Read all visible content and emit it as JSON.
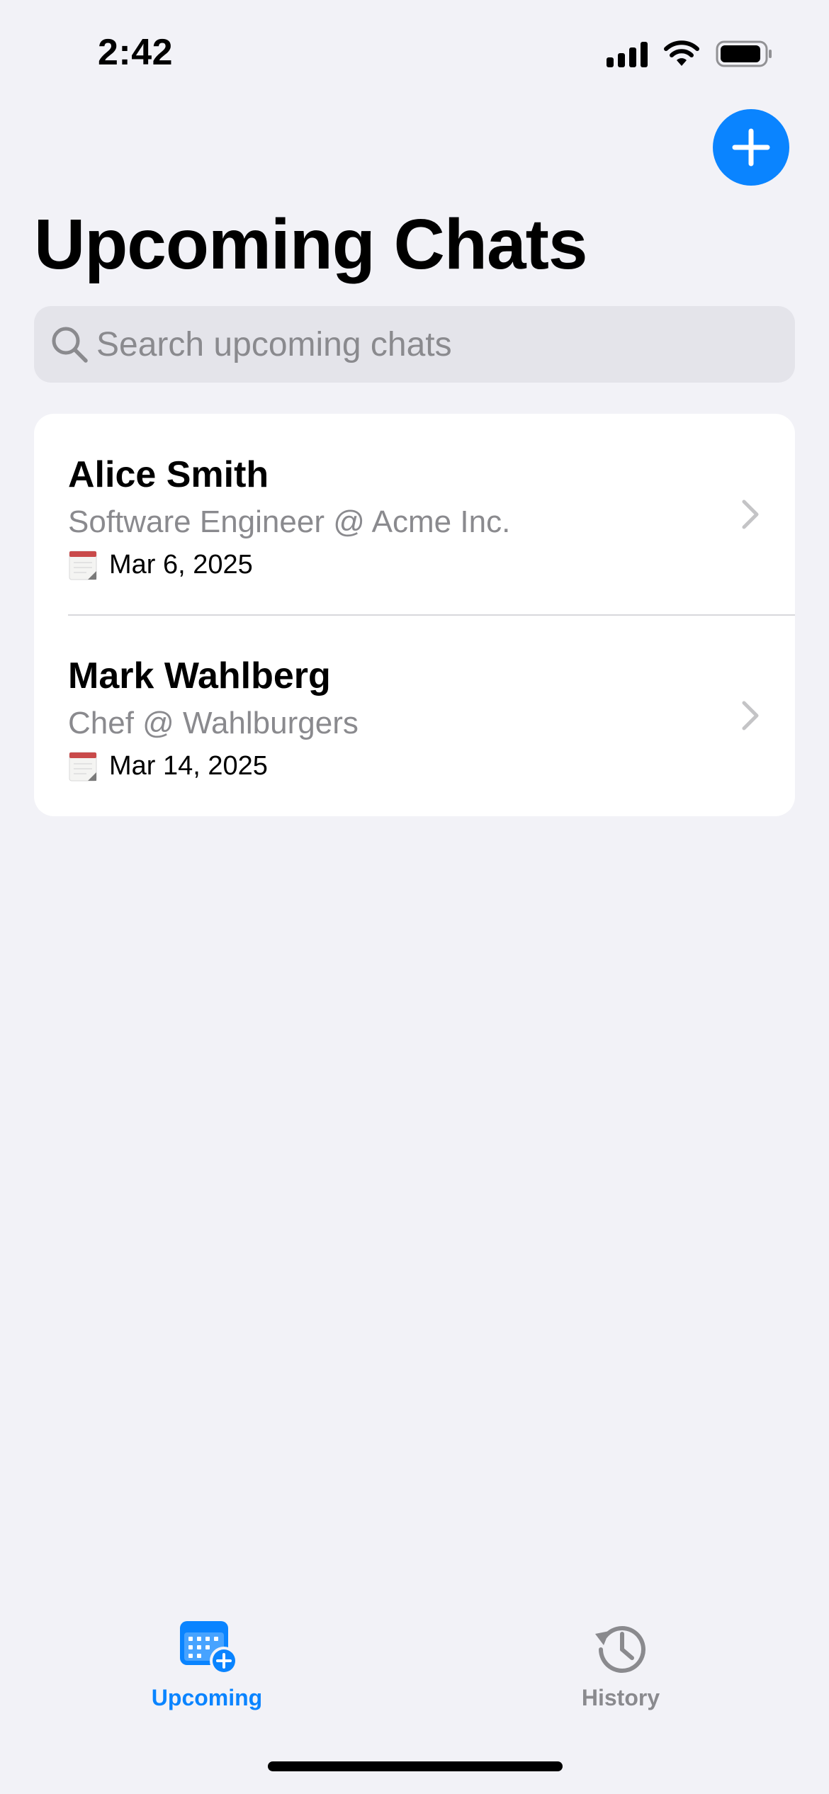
{
  "status_bar": {
    "time": "2:42",
    "icons": [
      "cellular-signal-icon",
      "wifi-icon",
      "battery-icon"
    ]
  },
  "header": {
    "add_button_icon": "plus-icon",
    "title": "Upcoming Chats"
  },
  "search": {
    "placeholder": "Search upcoming chats",
    "value": "",
    "icon": "search-icon"
  },
  "chats": [
    {
      "name": "Alice Smith",
      "subtitle": "Software Engineer @ Acme Inc.",
      "date": "Mar 6, 2025",
      "date_icon": "calendar-icon"
    },
    {
      "name": "Mark Wahlberg",
      "subtitle": "Chef @ Wahlburgers",
      "date": "Mar 14, 2025",
      "date_icon": "calendar-icon"
    }
  ],
  "tab_bar": {
    "tabs": [
      {
        "label": "Upcoming",
        "icon": "calendar-add-icon",
        "selected": true
      },
      {
        "label": "History",
        "icon": "history-clock-icon",
        "selected": false
      }
    ]
  },
  "colors": {
    "accent": "#0A84FF",
    "background": "#F2F2F7",
    "secondary_text": "#8A8A8E",
    "card": "#FFFFFF",
    "search_field": "#E4E4EA"
  }
}
